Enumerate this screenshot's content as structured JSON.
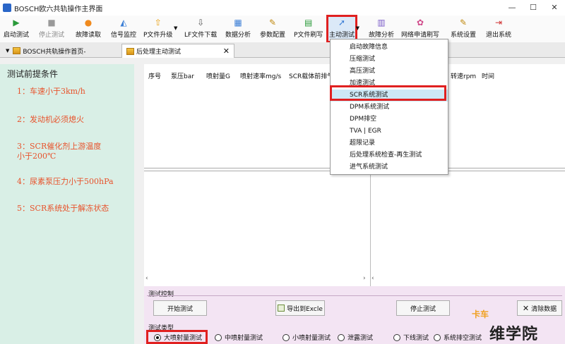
{
  "window": {
    "title": "BOSCH欧六共轨操作主界面",
    "minimize": "—",
    "restore": "☐",
    "close": "✕"
  },
  "toolbar": [
    {
      "label": "启动测试",
      "icon": "play-icon",
      "glyph": "▶",
      "color": "#2a9a3a"
    },
    {
      "label": "停止测试",
      "icon": "stop-icon",
      "glyph": "■",
      "color": "#999999",
      "disabled": true
    },
    {
      "label": "故障读取",
      "icon": "fault-read-icon",
      "glyph": "●",
      "color": "#f08a1e"
    },
    {
      "label": "信号监控",
      "icon": "signal-monitor-icon",
      "glyph": "◭",
      "color": "#3b7ed6"
    },
    {
      "label": "P文件升级",
      "icon": "upgrade-icon",
      "glyph": "⇧",
      "color": "#e8a010",
      "caret": "▼"
    },
    {
      "label": "LF文件下载",
      "icon": "download-icon",
      "glyph": "⇩",
      "color": "#555555"
    },
    {
      "label": "数据分析",
      "icon": "data-analysis-icon",
      "glyph": "▦",
      "color": "#3b7ed6"
    },
    {
      "label": "参数配置",
      "icon": "param-config-icon",
      "glyph": "✎",
      "color": "#c08a10"
    },
    {
      "label": "P文件刷写",
      "icon": "flash-icon",
      "glyph": "▤",
      "color": "#2a9a3a"
    },
    {
      "label": "主动测试",
      "icon": "active-test-icon",
      "glyph": "➚",
      "color": "#3b7ed6",
      "caret": "▼",
      "highlight": true
    },
    {
      "label": "故障分析",
      "icon": "fault-analysis-icon",
      "glyph": "▥",
      "color": "#7a5ac8"
    },
    {
      "label": "网络申请刷写",
      "icon": "network-icon",
      "glyph": "✿",
      "color": "#d04a8a"
    },
    {
      "label": "系统设置",
      "icon": "settings-icon",
      "glyph": "✎",
      "color": "#c08a10"
    },
    {
      "label": "退出系统",
      "icon": "exit-icon",
      "glyph": "⇥",
      "color": "#d03030"
    }
  ],
  "tabs": [
    {
      "label": "BOSCH共轨操作首页-",
      "arrow": "▼"
    },
    {
      "label": "后处理主动测试",
      "close": "✕"
    }
  ],
  "left": {
    "heading": "测试前提条件",
    "conditions": [
      "1：车速小于3km/h",
      "2：发动机必须熄火",
      "3：SCR催化剂上游温度\n小于200℃",
      "4：尿素泵压力小于500hPa",
      "5：SCR系统处于解冻状态"
    ]
  },
  "grid": {
    "columns": [
      "序号",
      "泵压bar",
      "喷射量G",
      "喷射速率mg/s",
      "SCR载体前排气",
      "转速rpm",
      "时间"
    ],
    "scroll_left": "‹",
    "scroll_right": "›"
  },
  "control": {
    "section_title": "测试控制",
    "start": "开始测试",
    "export": "导出到Excle",
    "stop": "停止测试",
    "clear": "清除数据",
    "clear_icon": "✕",
    "type_title": "测试类型",
    "types": [
      "大喷射量测试",
      "中喷射量测试",
      "小喷射量测试",
      "泄露测试",
      "下线测试",
      "系统排空测试"
    ],
    "selected_type": 0
  },
  "menu": {
    "items": [
      "启动故障信息",
      "压缩测试",
      "高压测试",
      "加速测试",
      "SCR系统测试",
      "DPM系统测试",
      "DPM排空",
      "TVA | EGR",
      "超限记录",
      "后处理系统检查-再生测试",
      "进气系统测试"
    ],
    "selected": 4
  },
  "watermark": {
    "top": "卡车",
    "main": "维学院"
  },
  "colors": {
    "highlight_red": "#e02020",
    "condition_orange": "#e8522b",
    "left_bg": "#d9efe6",
    "control_bg": "#f3e4f3",
    "menu_selected": "#cde8f6"
  }
}
